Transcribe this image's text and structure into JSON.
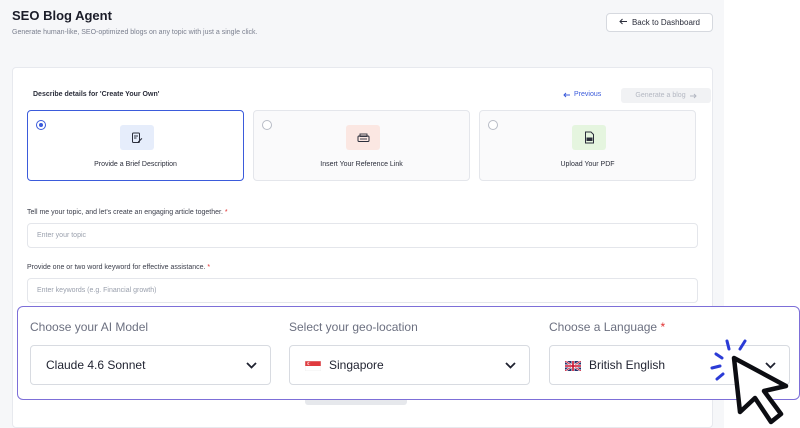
{
  "header": {
    "title": "SEO Blog Agent",
    "subtitle": "Generate human-like, SEO-optimized blogs on any topic with just a single click.",
    "back_button": "Back to Dashboard"
  },
  "card": {
    "heading": "Describe details for 'Create Your Own'",
    "previous_label": "Previous",
    "generate_label": "Generate a blog"
  },
  "options": [
    {
      "label": "Provide a Brief Description",
      "icon": "note-edit-icon",
      "icon_bg": "#e6edfb",
      "selected": true
    },
    {
      "label": "Insert Your Reference Link",
      "icon": "link-icon",
      "icon_bg": "#fbe7e2",
      "selected": false
    },
    {
      "label": "Upload Your PDF",
      "icon": "pdf-file-icon",
      "icon_bg": "#e5f5df",
      "selected": false
    }
  ],
  "topic": {
    "label": "Tell me your topic, and let's create an engaging article together.",
    "required_mark": "*",
    "placeholder": "Enter your topic"
  },
  "keywords": {
    "label": "Provide one or two word keyword for effective assistance.",
    "required_mark": "*",
    "placeholder": "Enter keywords (e.g. Financial growth)"
  },
  "settings": {
    "model": {
      "label": "Choose your AI Model",
      "value": "Claude 4.6 Sonnet"
    },
    "geo": {
      "label": "Select your geo-location",
      "value": "Singapore"
    },
    "language": {
      "label": "Choose a Language",
      "required_mark": "*",
      "value": "British English"
    }
  },
  "colors": {
    "accent": "#3b5bdb",
    "required": "#e03131",
    "panel_border": "#7d6fd8"
  }
}
